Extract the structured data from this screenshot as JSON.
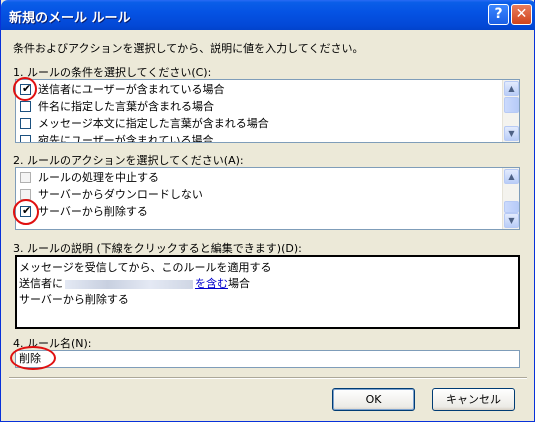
{
  "window": {
    "title": "新規のメール ルール",
    "help_label": "?",
    "close_label": "✕"
  },
  "instructions": "条件およびアクションを選択してから、説明に値を入力してください。",
  "conditions": {
    "label": "1. ルールの条件を選択してください(C):",
    "items": [
      {
        "label": "送信者にユーザーが含まれている場合",
        "checked": true
      },
      {
        "label": "件名に指定した言葉が含まれる場合",
        "checked": false
      },
      {
        "label": "メッセージ本文に指定した言葉が含まれる場合",
        "checked": false
      },
      {
        "label": "宛先にユーザーが含まれている場合",
        "checked": false
      }
    ]
  },
  "actions": {
    "label": "2. ルールのアクションを選択してください(A):",
    "items": [
      {
        "label": "ルールの処理を中止する",
        "checked": false,
        "disabled": true
      },
      {
        "label": "サーバーからダウンロードしない",
        "checked": false,
        "disabled": true
      },
      {
        "label": "サーバーから削除する",
        "checked": true,
        "disabled": false
      }
    ]
  },
  "description": {
    "label": "3. ルールの説明 (下線をクリックすると編集できます)(D):",
    "line1": "メッセージを受信してから、このルールを適用する",
    "line2_prefix": "送信者に",
    "line2_link": "を含む",
    "line2_suffix": "場合",
    "line3": "サーバーから削除する"
  },
  "rule_name": {
    "label": "4. ルール名(N):",
    "value": "削除"
  },
  "buttons": {
    "ok": "OK",
    "cancel": "キャンセル"
  },
  "colors": {
    "title_bar": "#0553E4",
    "highlight_circle": "#E01010",
    "link": "#0000CC"
  }
}
